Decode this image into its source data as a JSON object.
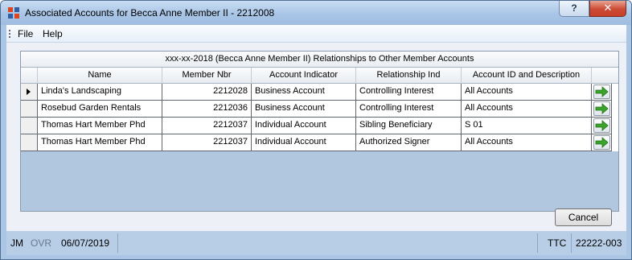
{
  "window": {
    "title": "Associated Accounts for Becca Anne Member II - 2212008",
    "help_label": "?",
    "close_label": "✕"
  },
  "menu": {
    "items": [
      "File",
      "Help"
    ]
  },
  "grid": {
    "caption": "xxx-xx-2018 (Becca Anne Member II) Relationships to Other Member Accounts",
    "columns": [
      "Name",
      "Member Nbr",
      "Account Indicator",
      "Relationship Ind",
      "Account ID and Description"
    ],
    "rows": [
      {
        "name": "Linda's Landscaping",
        "member_nbr": "2212028",
        "account_indicator": "Business Account",
        "relationship_ind": "Controlling Interest",
        "account_id": "All Accounts"
      },
      {
        "name": "Rosebud Garden Rentals",
        "member_nbr": "2212036",
        "account_indicator": "Business Account",
        "relationship_ind": "Controlling Interest",
        "account_id": "All Accounts"
      },
      {
        "name": "Thomas Hart Member Phd",
        "member_nbr": "2212037",
        "account_indicator": "Individual Account",
        "relationship_ind": "Sibling Beneficiary",
        "account_id": "S 01"
      },
      {
        "name": "Thomas Hart Member Phd",
        "member_nbr": "2212037",
        "account_indicator": "Individual Account",
        "relationship_ind": "Authorized Signer",
        "account_id": "All Accounts"
      }
    ],
    "go_icon": "green-right-arrow-icon",
    "arrow_color": "#3aa52a"
  },
  "buttons": {
    "cancel_label": "Cancel"
  },
  "status": {
    "user": "JM",
    "ovr": "OVR",
    "date": "06/07/2019",
    "ttc_label": "TTC",
    "ttc_code": "22222-003"
  }
}
